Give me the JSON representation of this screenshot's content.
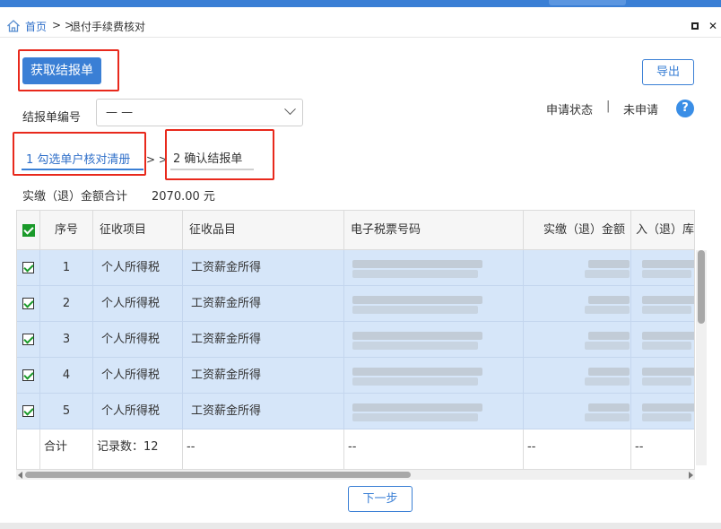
{
  "breadcrumb": {
    "home": "首页",
    "separator": "> >",
    "current": "退付手续费核对"
  },
  "toolbar": {
    "fetch_label": "获取结报单",
    "export_label": "导出"
  },
  "status": {
    "label": "申请状态",
    "separator": "|",
    "value": "未申请"
  },
  "help": {
    "glyph": "?"
  },
  "form": {
    "report_no_label": "结报单编号",
    "report_no_value": "— —"
  },
  "steps": {
    "step1": "1 勾选单户核对清册",
    "arrow": "> >",
    "step2": "2 确认结报单"
  },
  "summary": {
    "label": "实缴（退）金额合计",
    "value": "2070.00 元"
  },
  "table": {
    "columns": [
      "序号",
      "征收项目",
      "征收品目",
      "电子税票号码",
      "实缴（退）金额",
      "入（退）库"
    ],
    "rows": [
      {
        "no": "1",
        "item": "个人所得税",
        "category": "工资薪金所得"
      },
      {
        "no": "2",
        "item": "个人所得税",
        "category": "工资薪金所得"
      },
      {
        "no": "3",
        "item": "个人所得税",
        "category": "工资薪金所得"
      },
      {
        "no": "4",
        "item": "个人所得税",
        "category": "工资薪金所得"
      },
      {
        "no": "5",
        "item": "个人所得税",
        "category": "工资薪金所得"
      }
    ],
    "footer": {
      "label": "合计",
      "record_count": "记录数：12",
      "dash": "--"
    }
  },
  "next_label": "下一步",
  "colors": {
    "accent": "#3a7fd5",
    "highlight_box": "#e8291c",
    "row_selected": "#d6e6f9",
    "check_green": "#1a9a2a"
  }
}
